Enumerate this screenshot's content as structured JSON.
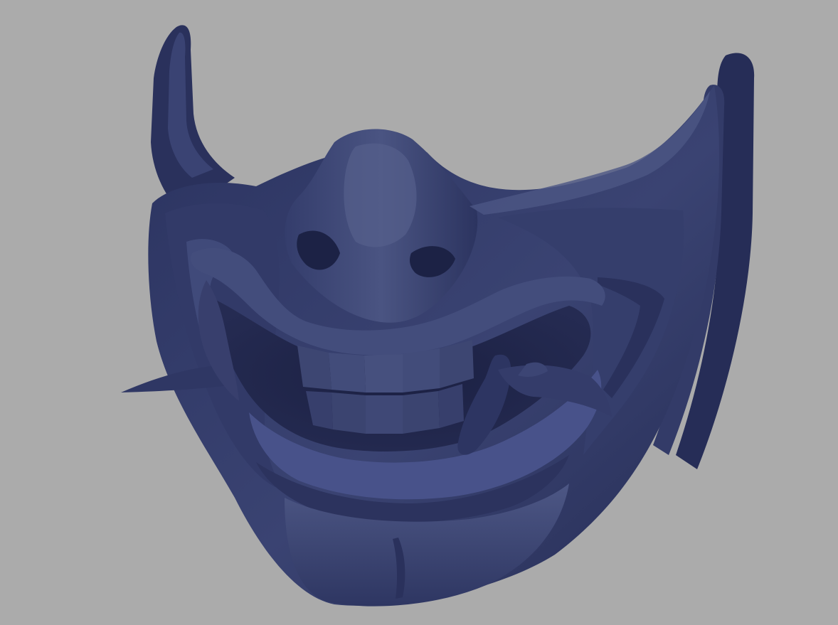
{
  "scene": {
    "subject": "oni-half-mask-render",
    "background_color": "#ababab",
    "mask_base_color": "#2f3763",
    "mask_mid_color": "#3d4675",
    "mask_light_color": "#58628f",
    "mask_shadow_color": "#1a1f3e",
    "teeth_color": "#3b4470",
    "tusk_color": "#343c6a"
  }
}
